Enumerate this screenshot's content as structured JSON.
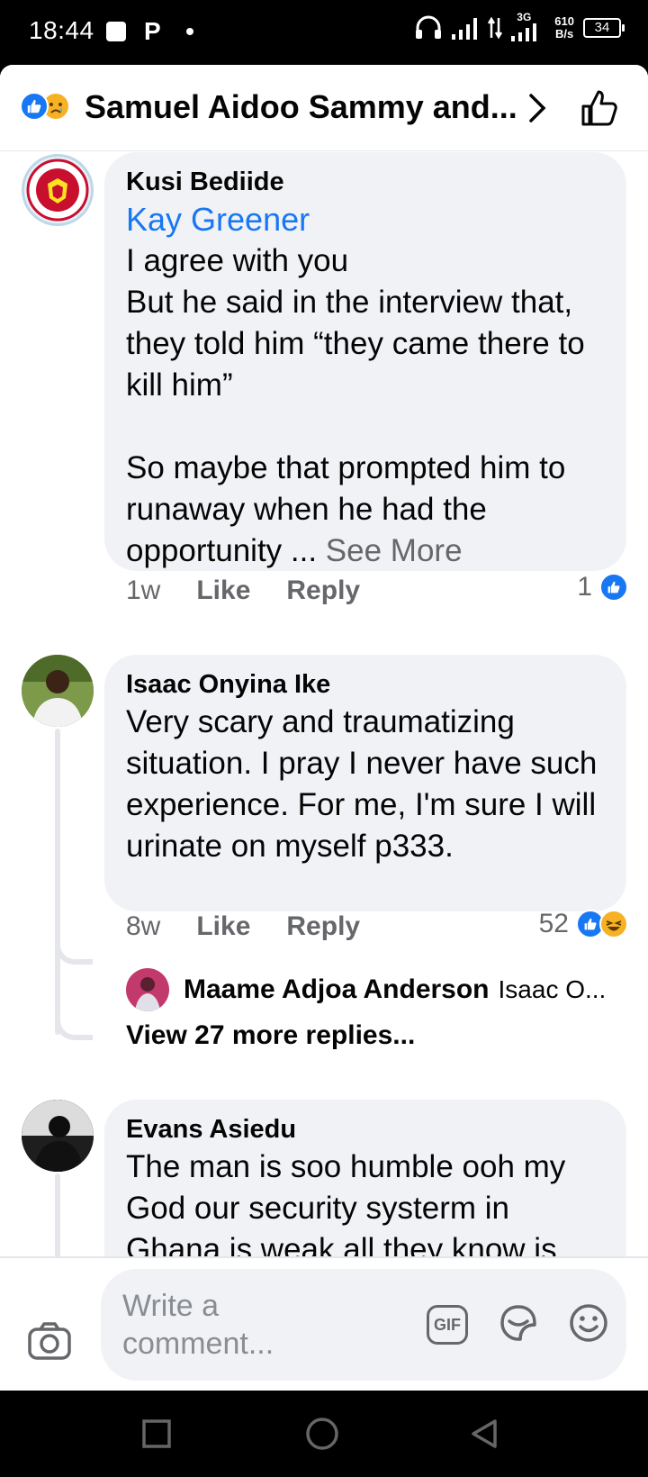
{
  "status_bar": {
    "time": "18:44",
    "net_speed_value": "610",
    "net_speed_unit": "B/s",
    "net_type": "3G",
    "battery": "34"
  },
  "header": {
    "title": "Samuel Aidoo Sammy and..."
  },
  "comments": [
    {
      "author": "Kusi Bediide",
      "mention": "Kay  Greener",
      "text": "I agree with you\nBut he said in the interview that, they told him “they came there to kill him”\n\nSo maybe that prompted him to runaway when he had the opportunity ... ",
      "see_more": "See More",
      "time": "1w",
      "like": "Like",
      "reply": "Reply",
      "reaction_count": "1"
    },
    {
      "author": "Isaac Onyina Ike",
      "text": "Very scary and traumatizing situation. I pray I never have such experience. For me, I'm sure I will urinate on myself p333.",
      "time": "8w",
      "like": "Like",
      "reply": "Reply",
      "reaction_count": "52",
      "reply_preview": {
        "author": "Maame Adjoa Anderson",
        "text": "Isaac O..."
      },
      "view_more": "View 27 more replies..."
    },
    {
      "author": "Evans Asiedu",
      "text": "The man is soo humble ooh my God our security systerm in Ghana is weak all they know is"
    }
  ],
  "composer": {
    "placeholder": "Write a comment...",
    "gif_label": "GIF"
  },
  "colors": {
    "accent": "#1877f2",
    "bubble": "#f0f2f5",
    "muted": "#65676b"
  }
}
